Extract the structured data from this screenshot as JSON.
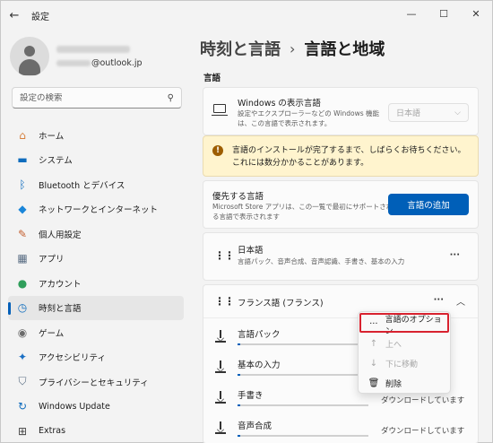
{
  "app": {
    "title": "設定",
    "back_glyph": "←",
    "minimize_glyph": "—",
    "maximize_glyph": "☐",
    "close_glyph": "✕"
  },
  "profile": {
    "email_suffix": "@outlook.jp"
  },
  "search": {
    "placeholder": "設定の検索",
    "icon": "search-icon",
    "icon_glyph": "⚲"
  },
  "sidebar": {
    "items": [
      {
        "label": "ホーム",
        "icon": "home-icon",
        "glyph": "⌂",
        "color": "#d67f3c"
      },
      {
        "label": "システム",
        "icon": "system-icon",
        "glyph": "▬",
        "color": "#0f6cbd"
      },
      {
        "label": "Bluetooth とデバイス",
        "icon": "bluetooth-icon",
        "glyph": "ᛒ",
        "color": "#0f6cbd"
      },
      {
        "label": "ネットワークとインターネット",
        "icon": "wifi-icon",
        "glyph": "◆",
        "color": "#1a86d9"
      },
      {
        "label": "個人用設定",
        "icon": "brush-icon",
        "glyph": "✎",
        "color": "#c45f2e"
      },
      {
        "label": "アプリ",
        "icon": "apps-icon",
        "glyph": "▦",
        "color": "#5a6e84"
      },
      {
        "label": "アカウント",
        "icon": "account-icon",
        "glyph": "●",
        "color": "#2f9e5b"
      },
      {
        "label": "時刻と言語",
        "icon": "time-language-icon",
        "glyph": "◷",
        "color": "#0f6cbd",
        "active": true
      },
      {
        "label": "ゲーム",
        "icon": "game-icon",
        "glyph": "◉",
        "color": "#6b6b6b"
      },
      {
        "label": "アクセシビリティ",
        "icon": "accessibility-icon",
        "glyph": "✦",
        "color": "#1a6fc4"
      },
      {
        "label": "プライバシーとセキュリティ",
        "icon": "shield-icon",
        "glyph": "⛉",
        "color": "#5a6e84"
      },
      {
        "label": "Windows Update",
        "icon": "windows-update-icon",
        "glyph": "↻",
        "color": "#0f6cbd"
      },
      {
        "label": "Extras",
        "icon": "extras-icon",
        "glyph": "⊞",
        "color": "#444444"
      }
    ]
  },
  "header": {
    "parent": "時刻と言語",
    "separator": "›",
    "current": "言語と地域"
  },
  "language_section": {
    "label": "言語",
    "display_language": {
      "title": "Windows の表示言語",
      "subtitle_line1": "設定やエクスプローラーなどの Windows 機能",
      "subtitle_line2": "は、この言語で表示されます。",
      "value": "日本語",
      "chevron": "⌵"
    },
    "warning": {
      "icon": "!",
      "text": "言語のインストールが完了するまで、しばらくお待ちください。これには数分かかることがあります。",
      "accent": "#9d5d00"
    },
    "preferred": {
      "title": "優先する言語",
      "subtitle_line1": "Microsoft Store アプリは、この一覧で最初にサポートされ",
      "subtitle_line2": "る言語で表示されます",
      "button": "言語の追加"
    },
    "languages": [
      {
        "name": "日本語",
        "details": "言語パック、音声合成、音声認識、手書き、基本の入力",
        "more": "···"
      },
      {
        "name": "フランス語 (フランス)",
        "more": "···",
        "collapse": "︿",
        "features": [
          {
            "name": "言語パック",
            "progress": 0.02,
            "status": ""
          },
          {
            "name": "基本の入力",
            "progress": 0.02,
            "status": ""
          },
          {
            "name": "手書き",
            "progress": 0.02,
            "status": "ダウンロードしています"
          },
          {
            "name": "音声合成",
            "progress": 0.02,
            "status": "ダウンロードしています"
          }
        ]
      }
    ]
  },
  "context_menu": {
    "items": [
      {
        "label": "言語のオプション",
        "glyph": "···",
        "enabled": true
      },
      {
        "label": "上へ",
        "glyph": "↑",
        "enabled": false
      },
      {
        "label": "下に移動",
        "glyph": "↓",
        "enabled": false
      },
      {
        "label": "削除",
        "glyph": "🗑",
        "enabled": true
      }
    ]
  }
}
